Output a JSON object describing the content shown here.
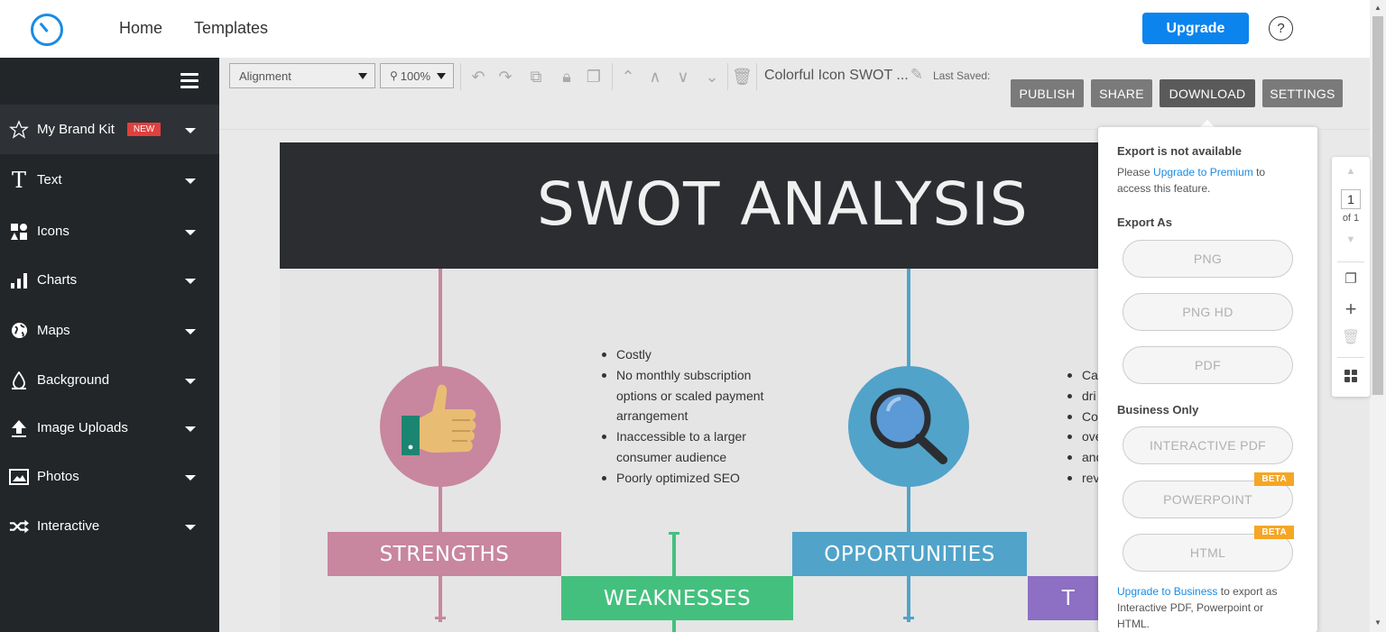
{
  "nav": {
    "links": [
      "Home",
      "Templates"
    ],
    "upgrade_label": "Upgrade",
    "help_label": "?"
  },
  "sidebar": {
    "items": [
      {
        "label": "My Brand Kit",
        "icon": "star-outline-icon",
        "badge": "NEW"
      },
      {
        "label": "Text",
        "icon": "text-t-icon"
      },
      {
        "label": "Icons",
        "icon": "shapes-icon"
      },
      {
        "label": "Charts",
        "icon": "bar-chart-icon"
      },
      {
        "label": "Maps",
        "icon": "globe-icon"
      },
      {
        "label": "Background",
        "icon": "paint-drop-icon"
      },
      {
        "label": "Image Uploads",
        "icon": "upload-icon"
      },
      {
        "label": "Photos",
        "icon": "photo-icon"
      },
      {
        "label": "Interactive",
        "icon": "shuffle-icon"
      }
    ]
  },
  "toolbar": {
    "alignment": "Alignment",
    "zoom": "100%",
    "doc_title": "Colorful Icon SWOT ...",
    "last_saved": "Last Saved:",
    "publish": "PUBLISH",
    "share": "SHARE",
    "download": "DOWNLOAD",
    "settings": "SETTINGS"
  },
  "canvas": {
    "title": "SWOT ANALYSIS",
    "weakness_bullets": [
      "Costly",
      "No monthly subscription options or scaled payment arrangement",
      "Inaccessible to a larger consumer audience",
      "Poorly optimized SEO"
    ],
    "threat_bullets_partial": [
      "Ca",
      "dri",
      "Co",
      "ove",
      "and",
      "rev"
    ],
    "labels": {
      "strengths": "STRENGTHS",
      "weaknesses": "WEAKNESSES",
      "opportunities": "OPPORTUNITIES",
      "threats": "T"
    },
    "colors": {
      "strengths": "#c8869f",
      "weaknesses": "#44c07e",
      "opportunities": "#51a3c9",
      "threats": "#8d6fc3",
      "header": "#2b2d31"
    }
  },
  "export_popup": {
    "not_available": "Export is not available",
    "please": "Please ",
    "upgrade_premium": "Upgrade to Premium",
    "to_access": " to access this feature.",
    "export_as": "Export As",
    "formats": [
      "PNG",
      "PNG HD",
      "PDF"
    ],
    "business_only": "Business Only",
    "business_formats": [
      "INTERACTIVE PDF",
      "POWERPOINT",
      "HTML"
    ],
    "beta": "BETA",
    "upgrade_business": "Upgrade to Business",
    "business_note": " to export as Interactive PDF, Powerpoint or HTML."
  },
  "page_panel": {
    "page": "1",
    "of": "of 1"
  },
  "accent_color": "#0b84ee"
}
